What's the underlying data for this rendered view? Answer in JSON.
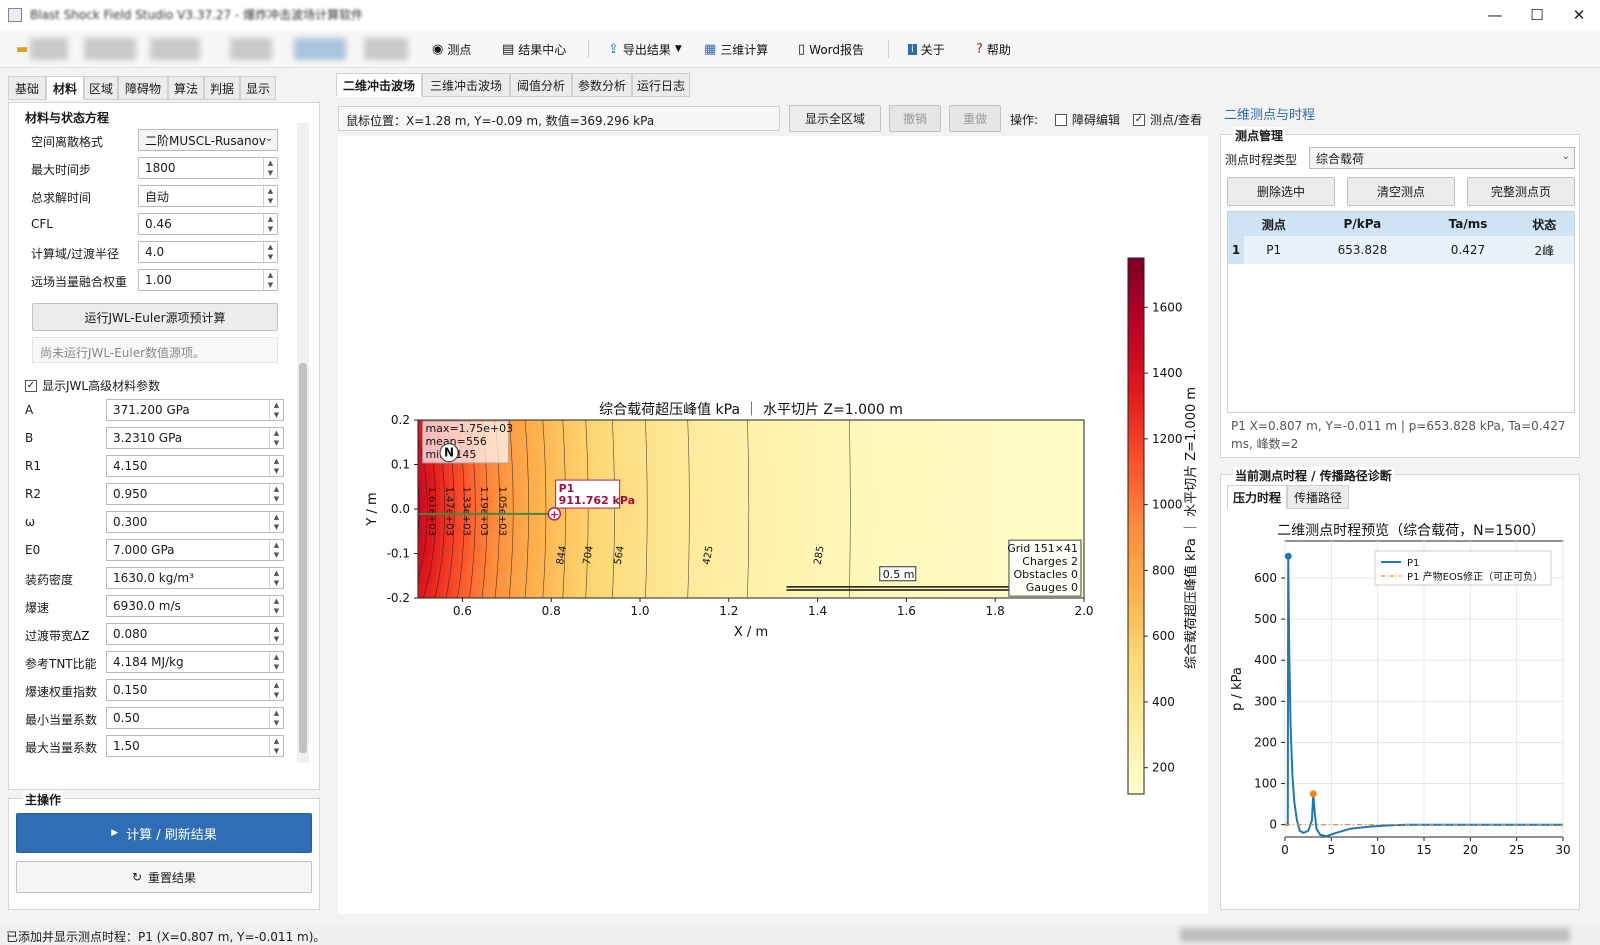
{
  "window": {
    "title": "Blast Shock Field Studio V3.37.27 - 爆炸冲击波场计算软件"
  },
  "toolbar": {
    "gauge_label": "测点",
    "results_label": "结果中心",
    "export_label": "导出结果",
    "calc3d_label": "三维计算",
    "word_label": "Word报告",
    "about_label": "关于",
    "help_label": "帮助"
  },
  "left_tabs": [
    "基础",
    "材料",
    "区域",
    "障碍物",
    "算法",
    "判据",
    "显示"
  ],
  "material": {
    "group_title": "材料与状态方程",
    "rows": [
      {
        "label": "空间离散格式",
        "value": "二阶MUSCL-Rusanov"
      },
      {
        "label": "最大时间步",
        "value": "1800"
      },
      {
        "label": "总求解时间",
        "value": "自动"
      },
      {
        "label": "CFL",
        "value": "0.46"
      },
      {
        "label": "计算域/过渡半径",
        "value": "4.0"
      },
      {
        "label": "远场当量融合权重",
        "value": "1.00"
      }
    ],
    "run_button": "运行JWL-Euler源项预计算",
    "run_status": "尚未运行JWL-Euler数值源项。",
    "show_adv": "显示JWL高级材料参数",
    "adv_rows": [
      {
        "label": "A",
        "value": "371.200 GPa"
      },
      {
        "label": "B",
        "value": "3.2310 GPa"
      },
      {
        "label": "R1",
        "value": "4.150"
      },
      {
        "label": "R2",
        "value": "0.950"
      },
      {
        "label": "ω",
        "value": "0.300"
      },
      {
        "label": "E0",
        "value": "7.000 GPa"
      },
      {
        "label": "装药密度",
        "value": "1630.0 kg/m³"
      },
      {
        "label": "爆速",
        "value": "6930.0 m/s"
      },
      {
        "label": "过渡带宽ΔZ",
        "value": "0.080"
      },
      {
        "label": "参考TNT比能",
        "value": "4.184 MJ/kg"
      },
      {
        "label": "爆速权重指数",
        "value": "0.150"
      },
      {
        "label": "最小当量系数",
        "value": "0.50"
      },
      {
        "label": "最大当量系数",
        "value": "1.50"
      }
    ]
  },
  "main_ops": {
    "title": "主操作",
    "compute": "计算 / 刷新结果",
    "reset": "重置结果"
  },
  "center_tabs": [
    "二维冲击波场",
    "三维冲击波场",
    "阈值分析",
    "参数分析",
    "运行日志"
  ],
  "viewer": {
    "mouse_pos": "鼠标位置：X=1.28 m, Y=-0.09 m, 数值=369.296 kPa",
    "show_all": "显示全区域",
    "undo": "撤销",
    "redo": "重做",
    "ops_label": "操作:",
    "obstacle_edit": "障碍编辑",
    "gauge_view": "测点/查看"
  },
  "right": {
    "section_title": "二维测点与时程",
    "mgmt_title": "测点管理",
    "type_label": "测点时程类型",
    "type_value": "综合载荷",
    "btn_delete": "删除选中",
    "btn_clear": "清空测点",
    "btn_full": "完整测点页",
    "table_headers": [
      "测点",
      "P/kPa",
      "Ta/ms",
      "状态"
    ],
    "table_rows": [
      {
        "idx": "1",
        "name": "P1",
        "p": "653.828",
        "ta": "0.427",
        "state": "2峰"
      }
    ],
    "info": "P1  X=0.807 m, Y=-0.011 m  |  p=653.828 kPa, Ta=0.427 ms, 峰数=2",
    "history_title": "当前测点时程 / 传播路径诊断",
    "history_tabs": [
      "压力时程",
      "传播路径"
    ]
  },
  "status_text": "已添加并显示测点时程：P1 (X=0.807 m, Y=-0.011 m)。",
  "chart_data": [
    {
      "type": "heatmap",
      "title": "综合载荷超压峰值 kPa ｜ 水平切片 Z=1.000 m",
      "xlabel": "X / m",
      "ylabel": "Y / m",
      "xlim": [
        0.5,
        2.0
      ],
      "ylim": [
        -0.2,
        0.2
      ],
      "xticks": [
        "0.6",
        "0.8",
        "1.0",
        "1.2",
        "1.4",
        "1.6",
        "1.8",
        "2.0"
      ],
      "yticks": [
        "0.2",
        "0.1",
        "0.0",
        "-0.1",
        "-0.2"
      ],
      "colorbar": {
        "label": "综合载荷超压峰值 kPa ｜ 水平切片 Z=1.000 m",
        "ticks": [
          "1600",
          "1400",
          "1200",
          "1000",
          "800",
          "600",
          "400",
          "200"
        ],
        "min": 120,
        "max": 1750
      },
      "contour_labels": [
        "1.61e+03",
        "1.47e+03",
        "1.33e+03",
        "1.19e+03",
        "1.05e+03",
        "844",
        "704",
        "564",
        "425",
        "285"
      ],
      "stats": [
        "max=1.75e+03",
        "mean=556",
        "min=145"
      ],
      "gauge": {
        "name": "P1",
        "value": "911.762 kPa",
        "x": 0.807,
        "y": -0.011
      },
      "scale_label": "0.5 m",
      "grid_info": [
        "Grid 151×41",
        "Charges 2",
        "Obstacles 0",
        "Gauges 0"
      ]
    },
    {
      "type": "line",
      "title": "二维测点时程预览（综合载荷，N=1500）",
      "xlabel": "",
      "ylabel": "p / kPa",
      "xlim": [
        0,
        30
      ],
      "ylim": [
        -30,
        690
      ],
      "xticks": [
        0,
        5,
        10,
        15,
        20,
        25,
        30
      ],
      "yticks": [
        0,
        100,
        200,
        300,
        400,
        500,
        600
      ],
      "series": [
        {
          "name": "P1",
          "color": "#1f77b4",
          "x": [
            0,
            0.3,
            0.35,
            0.45,
            0.6,
            0.8,
            1.0,
            1.3,
            1.6,
            2.0,
            2.5,
            2.9,
            3.05,
            3.2,
            3.4,
            3.8,
            4.5,
            5.5,
            7,
            9,
            11,
            13,
            15,
            18,
            21,
            25,
            30
          ],
          "y": [
            0,
            0,
            653,
            430,
            240,
            120,
            55,
            10,
            -15,
            -20,
            -15,
            10,
            75,
            30,
            -10,
            -25,
            -28,
            -20,
            -10,
            -5,
            -2,
            0,
            0,
            0,
            0,
            0,
            0
          ]
        },
        {
          "name": "P1 产物EOS修正（可正可负）",
          "color": "#ff7f0e",
          "dashed": true,
          "x": [
            0,
            5,
            10,
            15,
            20,
            25,
            30
          ],
          "y": [
            0,
            0,
            0,
            0,
            0,
            0,
            0
          ]
        }
      ],
      "markers": [
        {
          "x": 0.35,
          "y": 653,
          "color": "#1f77b4"
        },
        {
          "x": 3.05,
          "y": 75,
          "color": "#ff7f0e"
        }
      ]
    }
  ]
}
